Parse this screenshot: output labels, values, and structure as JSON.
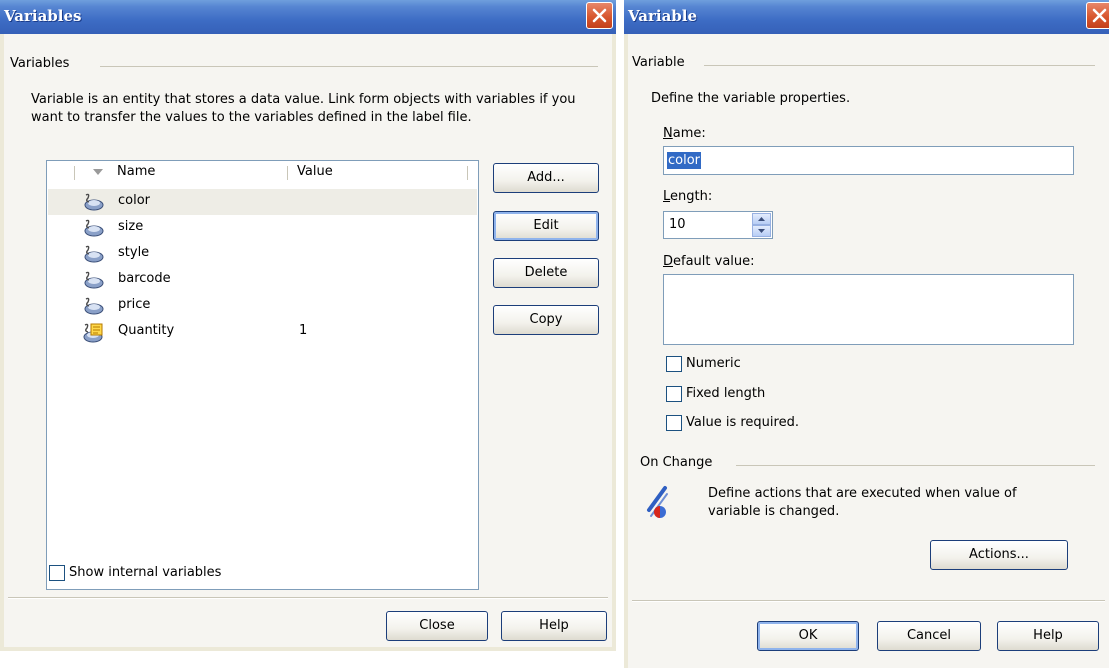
{
  "variables_dialog": {
    "title": "Variables",
    "group_label": "Variables",
    "description": "Variable is an entity that stores a data value. Link form objects with variables if you want to transfer the values to the variables defined in the label file.",
    "columns": {
      "name": "Name",
      "value": "Value"
    },
    "rows": [
      {
        "name": "color",
        "value": "",
        "icon": "variable-icon"
      },
      {
        "name": "size",
        "value": "",
        "icon": "variable-icon"
      },
      {
        "name": "style",
        "value": "",
        "icon": "variable-icon"
      },
      {
        "name": "barcode",
        "value": "",
        "icon": "variable-icon"
      },
      {
        "name": "price",
        "value": "",
        "icon": "variable-icon"
      },
      {
        "name": "Quantity",
        "value": "1",
        "icon": "variable-form-icon"
      }
    ],
    "buttons": {
      "add": "Add...",
      "edit": "Edit",
      "delete": "Delete",
      "copy": "Copy",
      "close": "Close",
      "help": "Help"
    },
    "show_internal": {
      "label": "Show internal variables",
      "checked": false
    }
  },
  "variable_dialog": {
    "title": "Variable",
    "group_label": "Variable",
    "description": "Define the variable properties.",
    "name_label_key": "N",
    "name_label_rest": "ame:",
    "name_value": "color",
    "length_label_key": "L",
    "length_label_rest": "ength:",
    "length_value": "10",
    "default_label_key": "D",
    "default_label_rest": "efault value:",
    "default_value": "",
    "checkboxes": {
      "numeric": "Numeric",
      "fixed_length": "Fixed length",
      "required": "Value is required."
    },
    "on_change_label": "On Change",
    "on_change_text_line1": "Define actions that are executed when value of",
    "on_change_text_line2": "variable is changed.",
    "buttons": {
      "actions": "Actions...",
      "ok": "OK",
      "cancel": "Cancel",
      "help": "Help"
    }
  },
  "colors": {
    "title_bar": "#3d6cc4",
    "close_button": "#d8572f",
    "dialog_bg": "#f6f5f1",
    "selection": "#316ac5"
  }
}
